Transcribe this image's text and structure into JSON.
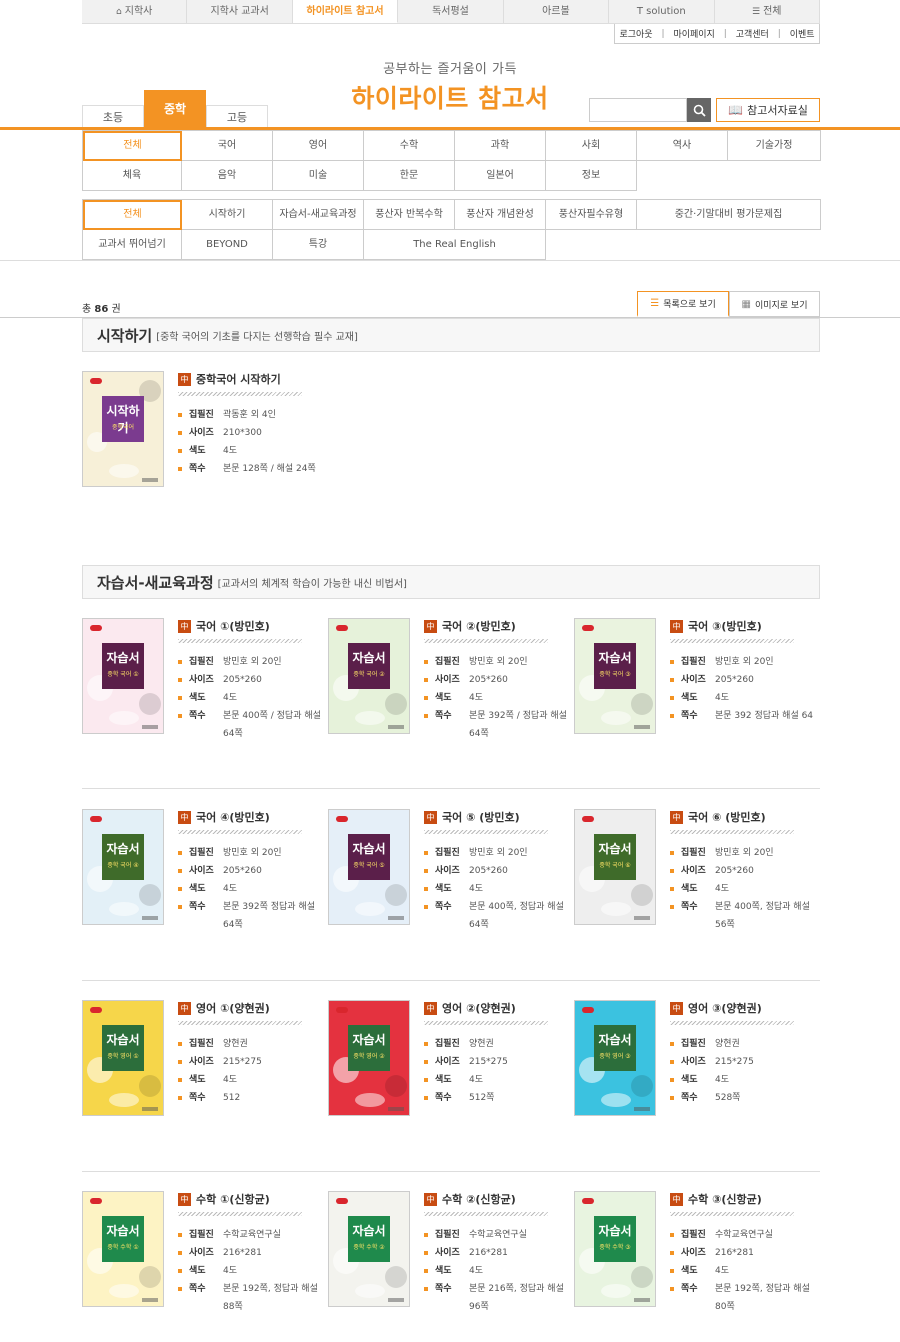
{
  "gnav": [
    {
      "label": "지학사",
      "icon": "home-icon"
    },
    {
      "label": "지학사 교과서"
    },
    {
      "label": "하이라이트 참고서",
      "active": true
    },
    {
      "label": "독서평설"
    },
    {
      "label": "아르볼"
    },
    {
      "label": "T solution"
    },
    {
      "label": "전체",
      "icon": "menu-icon"
    }
  ],
  "util": [
    "로그아웃",
    "마이페이지",
    "고객센터",
    "이벤트"
  ],
  "header": {
    "subtitle": "공부하는 즐거움이 가득",
    "title": "하이라이트 참고서"
  },
  "levels": [
    {
      "label": "초등"
    },
    {
      "label": "중학",
      "active": true
    },
    {
      "label": "고등"
    }
  ],
  "ref_button": "참고서자료실",
  "subjects": [
    [
      "전체",
      "국어",
      "영어",
      "수학",
      "과학",
      "사회",
      "역사",
      "기술가정"
    ],
    [
      "체육",
      "음악",
      "미술",
      "한문",
      "일본어",
      "정보"
    ]
  ],
  "series": [
    [
      "전체",
      "시작하기",
      "자습서-새교육과정",
      "풍산자 반복수학",
      "풍산자 개념완성",
      "풍산자필수유형",
      "중간·기말대비 평가문제집"
    ],
    [
      "교과서 뛰어넘기",
      "BEYOND",
      "특강",
      "The Real English"
    ]
  ],
  "count": {
    "prefix": "총",
    "value": "86",
    "suffix": "권"
  },
  "view_buttons": [
    "목록으로 보기",
    "이미지로 보기"
  ],
  "sections": [
    {
      "name": "시작하기",
      "desc": "[중학 국어의 기초를 다지는 선행학습 필수 교재]"
    },
    {
      "name": "자습서-새교육과정",
      "desc": "[교과서의 체계적 학습이 가능한 내신 비법서]"
    }
  ],
  "spec_labels": {
    "author": "집필진",
    "size": "사이즈",
    "color": "색도",
    "pages": "쪽수"
  },
  "badge": "中",
  "books": [
    {
      "name": "중학국어 시작하기",
      "author": "곽동훈 외 4인",
      "size": "210*300",
      "color": "4도",
      "pages": "본문 128쪽 / 해설 24쪽",
      "cover_title": "시작하기",
      "cover_sub": "중학국어",
      "cover_bg": "#f7f0d8",
      "cover_accent": "#7b3b8f"
    },
    {
      "name": "국어 ①(방민호)",
      "author": "방민호 외 20인",
      "size": "205*260",
      "color": "4도",
      "pages": "본문 400쪽 / 정답과 해설 64쪽",
      "cover_title": "자습서",
      "cover_sub": "중학 국어 ①",
      "cover_bg": "#fbe9ef",
      "cover_accent": "#5b1f4a"
    },
    {
      "name": "국어 ②(방민호)",
      "author": "방민호 외 20인",
      "size": "205*260",
      "color": "4도",
      "pages": "본문 392쪽 / 정답과 해설 64쪽",
      "cover_title": "자습서",
      "cover_sub": "중학 국어 ②",
      "cover_bg": "#e6f2da",
      "cover_accent": "#5b1f4a"
    },
    {
      "name": "국어 ③(방민호)",
      "author": "방민호 외 20인",
      "size": "205*260",
      "color": "4도",
      "pages": "본문 392 정답과 해설 64",
      "cover_title": "자습서",
      "cover_sub": "중학 국어 ③",
      "cover_bg": "#eaf3df",
      "cover_accent": "#5b1f4a"
    },
    {
      "name": "국어 ④(방민호)",
      "author": "방민호 외 20인",
      "size": "205*260",
      "color": "4도",
      "pages": "본문 392쪽 정답과 해설 64쪽",
      "cover_title": "자습서",
      "cover_sub": "중학 국어 ④",
      "cover_bg": "#e3f0f7",
      "cover_accent": "#3f6b2a"
    },
    {
      "name": "국어 ⑤ (방민호)",
      "author": "방민호 외 20인",
      "size": "205*260",
      "color": "4도",
      "pages": "본문 400쪽, 정답과 해설 64쪽",
      "cover_title": "자습서",
      "cover_sub": "중학 국어 ⑤",
      "cover_bg": "#e5eff8",
      "cover_accent": "#5b1f4a"
    },
    {
      "name": "국어 ⑥ (방민호)",
      "author": "방민호 외 20인",
      "size": "205*260",
      "color": "4도",
      "pages": "본문 400쪽, 정답과 해설 56쪽",
      "cover_title": "자습서",
      "cover_sub": "중학 국어 ⑥",
      "cover_bg": "#eeeeee",
      "cover_accent": "#3f6b2a"
    },
    {
      "name": "영어 ①(양현권)",
      "author": "양현권",
      "size": "215*275",
      "color": "4도",
      "pages": "512",
      "cover_title": "자습서",
      "cover_sub": "중학 영어 ①",
      "cover_bg": "#f6d64a",
      "cover_accent": "#2c6e3b"
    },
    {
      "name": "영어 ②(양현권)",
      "author": "양현권",
      "size": "215*275",
      "color": "4도",
      "pages": "512쪽",
      "cover_title": "자습서",
      "cover_sub": "중학 영어 ②",
      "cover_bg": "#e4323f",
      "cover_accent": "#2c6e3b"
    },
    {
      "name": "영어 ③(양현권)",
      "author": "양현권",
      "size": "215*275",
      "color": "4도",
      "pages": "528쪽",
      "cover_title": "자습서",
      "cover_sub": "중학 영어 ③",
      "cover_bg": "#3bc2e0",
      "cover_accent": "#2c6e3b"
    },
    {
      "name": "수학 ①(신항균)",
      "author": "수학교육연구실",
      "size": "216*281",
      "color": "4도",
      "pages": "본문 192쪽, 정답과 해설 88쪽",
      "cover_title": "자습서",
      "cover_sub": "중학 수학 ①",
      "cover_bg": "#fdf3c4",
      "cover_accent": "#1f8a4c"
    },
    {
      "name": "수학 ②(신항균)",
      "author": "수학교육연구실",
      "size": "216*281",
      "color": "4도",
      "pages": "본문 216쪽, 정답과 해설 96쪽",
      "cover_title": "자습서",
      "cover_sub": "중학 수학 ②",
      "cover_bg": "#f3f3ee",
      "cover_accent": "#1f8a4c"
    },
    {
      "name": "수학 ③(신항균)",
      "author": "수학교육연구실",
      "size": "216*281",
      "color": "4도",
      "pages": "본문 192쪽, 정답과 해설 80쪽",
      "cover_title": "자습서",
      "cover_sub": "중학 수학 ③",
      "cover_bg": "#e8f4e0",
      "cover_accent": "#1f8a4c"
    }
  ]
}
